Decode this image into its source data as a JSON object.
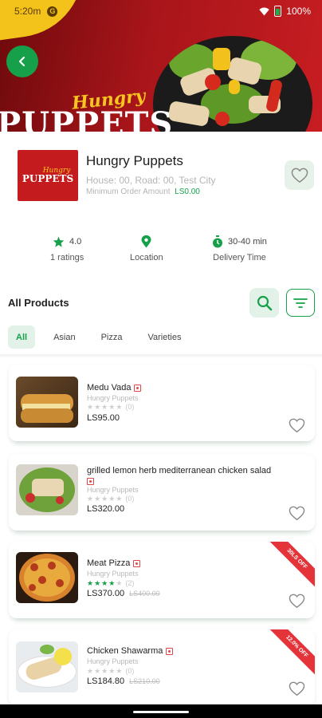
{
  "status_bar": {
    "time": "5:20",
    "time_suffix": "m",
    "google_glyph": "G",
    "battery": "100%"
  },
  "banner": {
    "hungry_text": "Hungry",
    "puppets_text": "PUPPETS"
  },
  "restaurant": {
    "logo_small": "Hungry",
    "logo_big": "PUPPETS",
    "name": "Hungry Puppets",
    "address": "House: 00, Road: 00, Test City",
    "min_order_label": "Minimum Order Amount",
    "min_order_value": "LS0.00"
  },
  "stats": {
    "rating": "4.0",
    "ratings_count": "1 ratings",
    "location_label": "Location",
    "delivery_time": "30-40 min",
    "delivery_label": "Delivery Time"
  },
  "products_header": {
    "title": "All Products"
  },
  "tabs": [
    "All",
    "Asian",
    "Pizza",
    "Varieties"
  ],
  "products": [
    {
      "name": "Medu Vada",
      "shop": "Hungry Puppets",
      "rating": 0,
      "count": "(0)",
      "price": "LS95.00",
      "old_price": "",
      "badge": ""
    },
    {
      "name": "grilled lemon herb mediterranean chicken salad",
      "shop": "Hungry Puppets",
      "rating": 0,
      "count": "(0)",
      "price": "LS320.00",
      "old_price": "",
      "badge": ""
    },
    {
      "name": "Meat Pizza",
      "shop": "Hungry Puppets",
      "rating": 4,
      "count": "(2)",
      "price": "LS370.00",
      "old_price": "LS400.00",
      "badge": "30LS OFF"
    },
    {
      "name": "Chicken Shawarma",
      "shop": "Hungry Puppets",
      "rating": 0,
      "count": "(0)",
      "price": "LS184.80",
      "old_price": "LS210.00",
      "badge": "12.0% OFF"
    }
  ],
  "colors": {
    "brand_green": "#17a04a",
    "banner_red": "#b5181c",
    "accent_yellow": "#f3c21b",
    "ribbon_red": "#e5333a"
  },
  "icons": {
    "back": "back-arrow-icon",
    "favorite": "heart-icon",
    "search": "search-icon",
    "filter": "filter-icon",
    "star": "star-icon",
    "location": "location-pin-icon",
    "timer": "stopwatch-icon"
  }
}
